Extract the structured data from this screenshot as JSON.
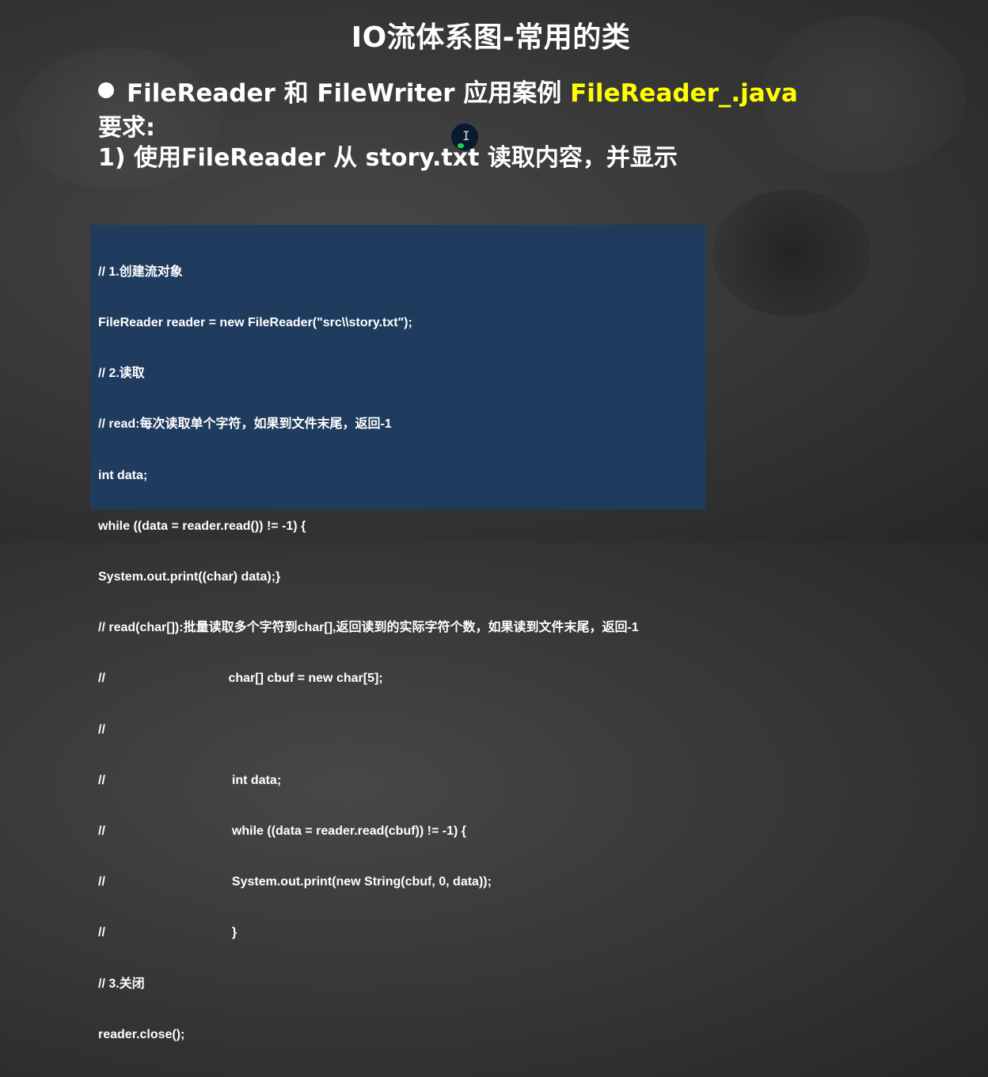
{
  "slide": {
    "title": "IO流体系图-常用的类",
    "bullet": {
      "prefix": "FileReader 和 FileWriter 应用案例 ",
      "file": "FileReader_.java"
    },
    "requirement_label": "要求:",
    "requirement_item": "1) 使用FileReader 从 story.txt 读取内容，并显示"
  },
  "code": {
    "lines": [
      "// 1.创建流对象",
      "FileReader reader = new FileReader(\"src\\\\story.txt\");",
      "// 2.读取",
      "// read:每次读取单个字符，如果到文件末尾，返回-1",
      "int data;",
      "while ((data = reader.read()) != -1) {",
      "System.out.print((char) data);}",
      "// read(char[]):批量读取多个字符到char[],返回读到的实际字符个数，如果读到文件末尾，返回-1",
      "//                                   char[] cbuf = new char[5];",
      "//",
      "//                                    int data;",
      "//                                    while ((data = reader.read(cbuf)) != -1) {",
      "//                                    System.out.print(new String(cbuf, 0, data));",
      "//                                    }",
      "// 3.关闭",
      "reader.close();"
    ]
  },
  "colors": {
    "background": "#3a3a3a",
    "title_text": "#ffffff",
    "highlight": "#ffff00",
    "code_panel": "#1f3c5f",
    "cursor_marker": "#22cc55"
  },
  "icons": {
    "bullet": "filled-circle",
    "cursor": "text-cursor-icon"
  }
}
